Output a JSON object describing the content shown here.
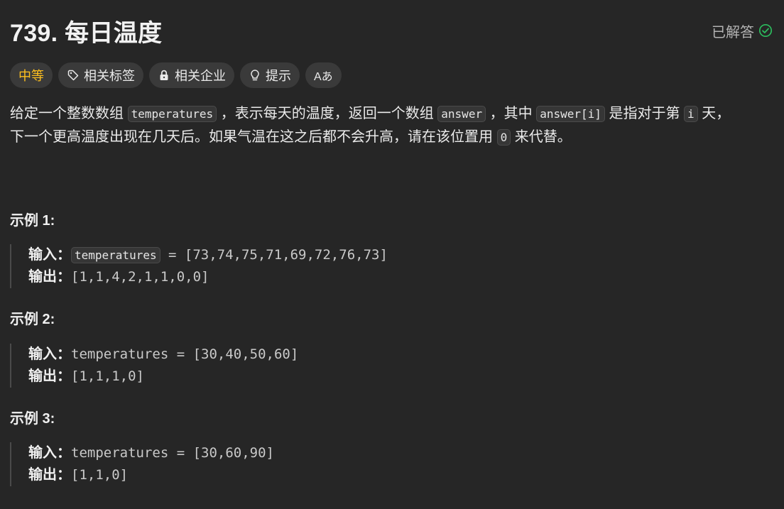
{
  "problem": {
    "title": "739. 每日温度",
    "status": "已解答"
  },
  "tags": {
    "difficulty": "中等",
    "related_tags": "相关标签",
    "related_companies": "相关企业",
    "hints": "提示",
    "translate": "Aあ"
  },
  "description": {
    "p1_a": "给定一个整数数组 ",
    "code_temperatures": "temperatures",
    "p1_b": " ，表示每天的温度，返回一个数组 ",
    "code_answer": "answer",
    "p1_c": " ，其中 ",
    "code_answer_i": "answer[i]",
    "p1_d": " 是指对于第 ",
    "code_i": "i",
    "p1_e": " 天，",
    "p2_a": "下一个更高温度出现在几天后。如果气温在这之后都不会升高，请在该位置用 ",
    "code_zero": "0",
    "p2_b": " 来代替。"
  },
  "examples": [
    {
      "title": "示例 1:",
      "input_label": "输入：",
      "input_var": "temperatures",
      "input_rest": " = [73,74,75,71,69,72,76,73]",
      "output_label": "输出：",
      "output_value": "[1,1,4,2,1,1,0,0]"
    },
    {
      "title": "示例 2:",
      "input_label": "输入：",
      "input_value": "temperatures = [30,40,50,60]",
      "output_label": "输出：",
      "output_value": "[1,1,1,0]"
    },
    {
      "title": "示例 3:",
      "input_label": "输入：",
      "input_value": "temperatures = [30,60,90]",
      "output_label": "输出：",
      "output_value": "[1,1,0]"
    }
  ],
  "icons": {
    "solved": "check-circle-icon",
    "tag": "tag-icon",
    "lock": "lock-icon",
    "hint": "lightbulb-icon",
    "translate": "translate-icon"
  },
  "colors": {
    "background": "#262626",
    "difficulty_medium": "#ffc01e",
    "solved_check": "#2cbb5d",
    "chip": "#3a3a3a"
  }
}
